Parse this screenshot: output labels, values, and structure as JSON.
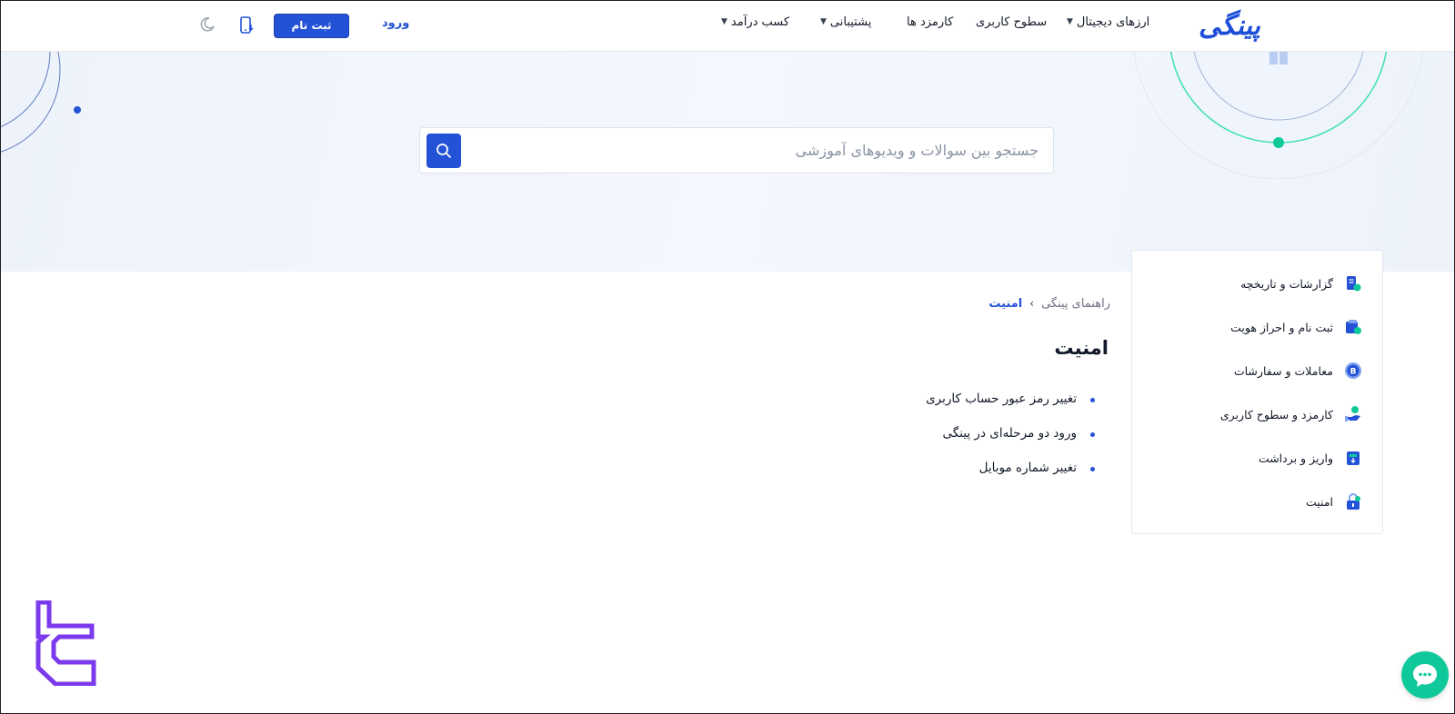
{
  "header": {
    "logo_text": "پینگی",
    "nav": [
      {
        "label": "ارزهای دیجیتال",
        "has_dropdown": true
      },
      {
        "label": "سطوح کاربری",
        "has_dropdown": false
      },
      {
        "label": "کارمزد ها",
        "has_dropdown": false
      },
      {
        "label": "پشتیبانی",
        "has_dropdown": true
      },
      {
        "label": "کسب درآمد",
        "has_dropdown": true
      }
    ],
    "login_label": "ورود",
    "signup_label": "ثبت نام",
    "app_icon": "mobile-download-icon",
    "theme_icon": "moon-icon"
  },
  "search": {
    "placeholder": "جستجو بین سوالات و ویدیوهای آموزشی",
    "value": "",
    "button_icon": "search-icon"
  },
  "sidebar": {
    "items": [
      {
        "label": "گزارشات و تاریخچه",
        "icon": "report-history-icon"
      },
      {
        "label": "ثبت نام و احراز هویت",
        "icon": "signup-verify-icon"
      },
      {
        "label": "معاملات و سفارشات",
        "icon": "bitcoin-trade-icon"
      },
      {
        "label": "کارمزد و سطوح کاربری",
        "icon": "fee-levels-icon"
      },
      {
        "label": "واریز و برداشت",
        "icon": "deposit-withdraw-icon"
      },
      {
        "label": "امنیت",
        "icon": "lock-icon"
      }
    ]
  },
  "breadcrumb": {
    "root": "راهنمای پینگی",
    "separator": "›",
    "current": "امنیت"
  },
  "main": {
    "title": "امنیت",
    "articles": [
      "تغییر رمز عبور حساب کاربری",
      "ورود دو مرحله‌ای در پینگی",
      "تغییر شماره موبایل"
    ]
  },
  "chat": {
    "icon": "chat-bubble-icon"
  },
  "colors": {
    "primary": "#2452d6",
    "accent_green": "#10c99a",
    "hero_bg": "#eef3fb",
    "watermark_purple": "#7c3aed"
  }
}
